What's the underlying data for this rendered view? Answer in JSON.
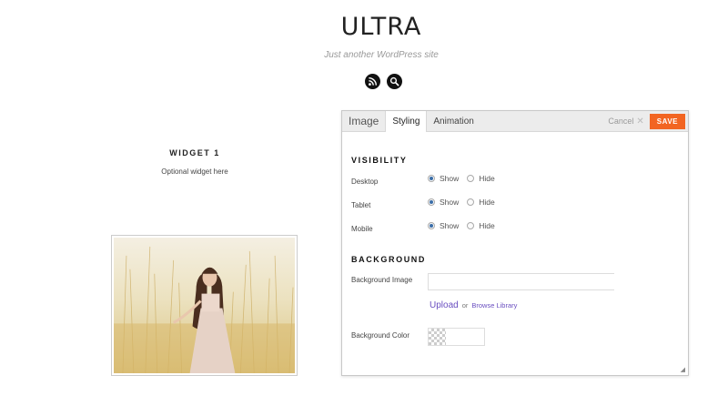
{
  "site": {
    "title": "ULTRA",
    "tagline": "Just another WordPress site",
    "icons": [
      "rss-icon",
      "search-icon"
    ]
  },
  "widget": {
    "title": "WIDGET 1",
    "text": "Optional widget here"
  },
  "panel": {
    "tabs": [
      {
        "label": "Image",
        "active": false
      },
      {
        "label": "Styling",
        "active": true
      },
      {
        "label": "Animation",
        "active": false
      }
    ],
    "cancel_label": "Cancel",
    "save_label": "SAVE",
    "visibility": {
      "title": "VISIBILITY",
      "rows": [
        {
          "label": "Desktop",
          "selected": "Show"
        },
        {
          "label": "Tablet",
          "selected": "Show"
        },
        {
          "label": "Mobile",
          "selected": "Show"
        }
      ],
      "show_label": "Show",
      "hide_label": "Hide"
    },
    "background": {
      "title": "BACKGROUND",
      "image_label": "Background Image",
      "image_value": "",
      "upload_label": "Upload",
      "or_label": "or",
      "browse_label": "Browse Library",
      "color_label": "Background Color"
    }
  },
  "colors": {
    "save_button": "#f26522",
    "link": "#6a4fc0",
    "radio_checked": "#3b6ea8"
  }
}
